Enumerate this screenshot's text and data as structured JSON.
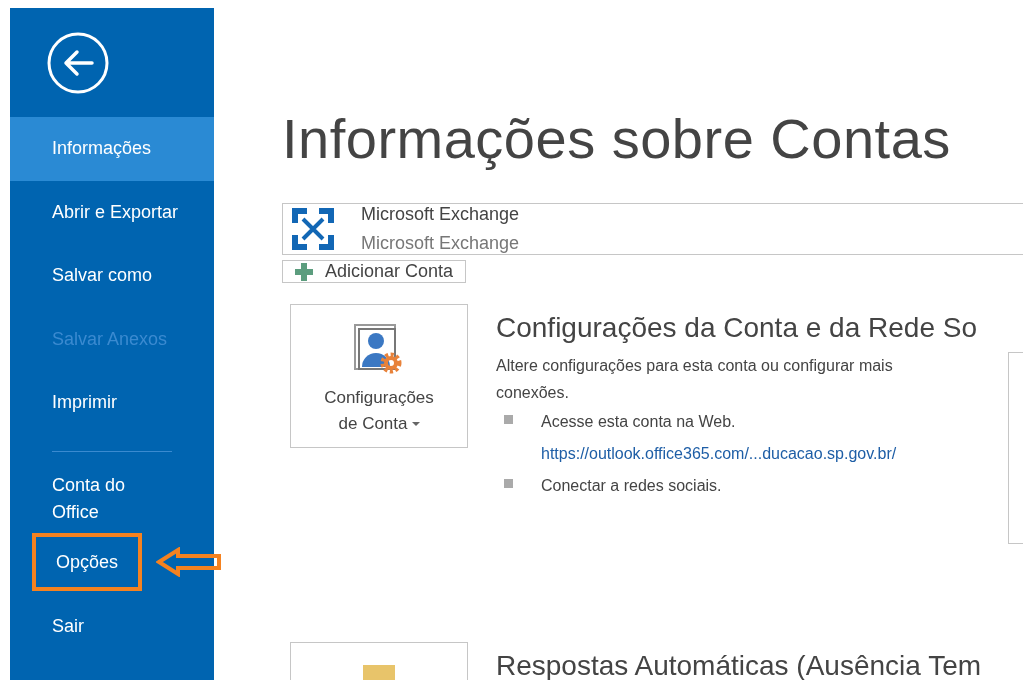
{
  "sidebar": {
    "items": [
      {
        "label": "Informações",
        "selected": true,
        "disabled": false,
        "highlighted": false,
        "kind": "item"
      },
      {
        "label": "Abrir e Exportar",
        "selected": false,
        "disabled": false,
        "highlighted": false,
        "kind": "item"
      },
      {
        "label": "Salvar como",
        "selected": false,
        "disabled": false,
        "highlighted": false,
        "kind": "item"
      },
      {
        "label": "Salvar Anexos",
        "selected": false,
        "disabled": true,
        "highlighted": false,
        "kind": "item"
      },
      {
        "label": "Imprimir",
        "selected": false,
        "disabled": false,
        "highlighted": false,
        "kind": "item"
      },
      {
        "kind": "separator"
      },
      {
        "label": "Conta do Office",
        "selected": false,
        "disabled": false,
        "highlighted": false,
        "kind": "item"
      },
      {
        "label": "Opções",
        "selected": false,
        "disabled": false,
        "highlighted": true,
        "kind": "item"
      },
      {
        "label": "Sair",
        "selected": false,
        "disabled": false,
        "highlighted": false,
        "kind": "item"
      }
    ]
  },
  "page_title": "Informações sobre Contas",
  "account": {
    "name": "Microsoft Exchange",
    "type": "Microsoft Exchange"
  },
  "add_account_button": "Adicionar Conta",
  "sections": [
    {
      "button": [
        "Configurações",
        "de Conta"
      ],
      "has_dropdown": true,
      "kind": "settings",
      "title": "Configurações da Conta e da Rede So",
      "description": "Altere configurações para esta conta ou configurar mais conexões.",
      "bullets": [
        {
          "text": "Acesse esta conta na Web.",
          "link": "https://outlook.office365.com/...ducacao.sp.gov.br/"
        },
        {
          "text": "Conectar a redes sociais."
        }
      ]
    },
    {
      "kind": "auto-reply",
      "title": "Respostas Automáticas (Ausência Tem"
    }
  ]
}
